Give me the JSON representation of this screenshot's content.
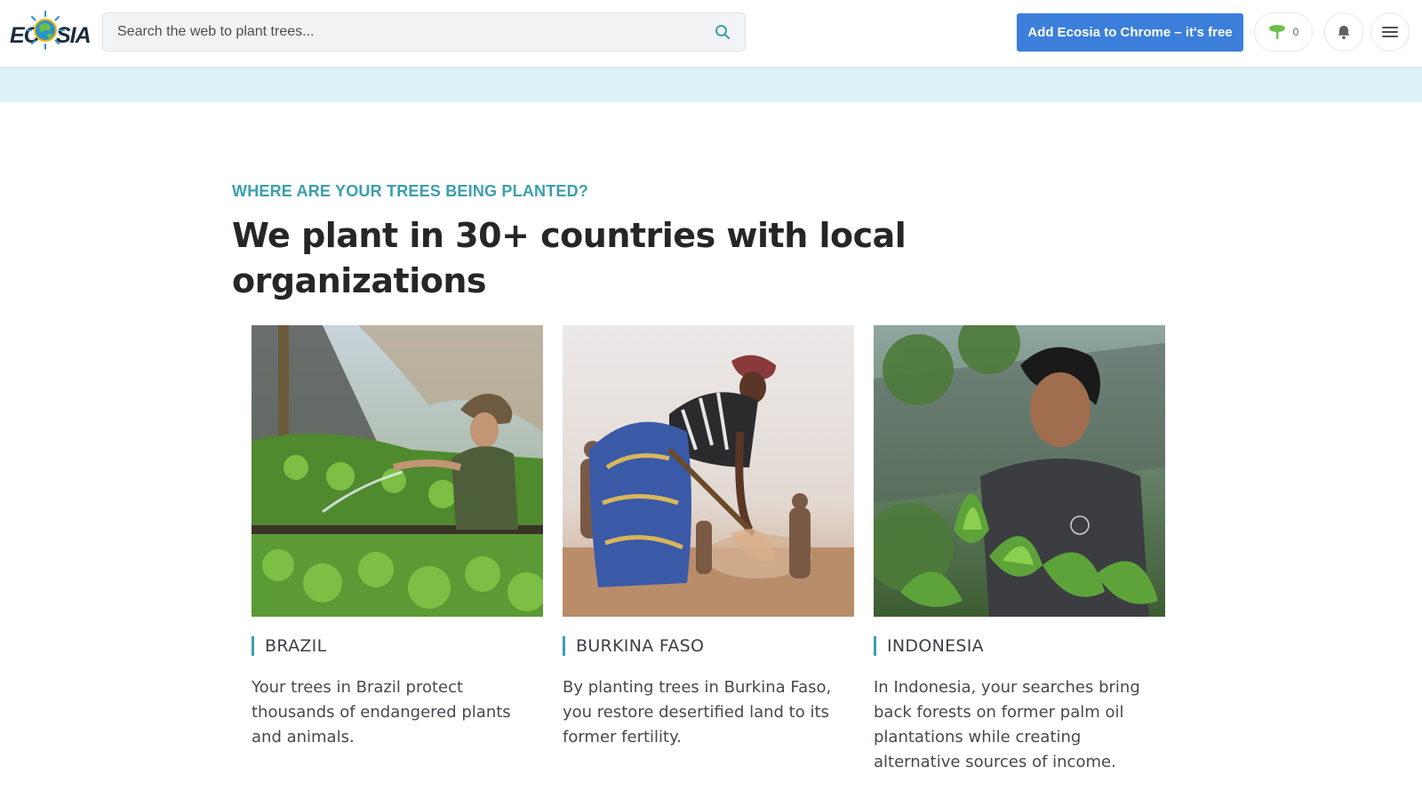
{
  "header": {
    "logo_left": "EC",
    "logo_right": "SIA",
    "search": {
      "placeholder": "Search the web to plant trees...",
      "value": ""
    },
    "chrome_button_label": "Add Ecosia to Chrome – it's free",
    "tree_count": "0",
    "icons": {
      "search": "search-icon",
      "tree": "tree-icon",
      "bell": "bell-icon",
      "menu": "hamburger-menu-icon"
    }
  },
  "main": {
    "eyebrow": "WHERE ARE YOUR TREES BEING PLANTED?",
    "headline": "We plant in 30+ countries with local organizations",
    "cards": [
      {
        "country": "BRAZIL",
        "description": "Your trees in Brazil protect thousands of endangered plants and animals."
      },
      {
        "country": "BURKINA FASO",
        "description": "By planting trees in Burkina Faso, you restore desertified land to its former fertility."
      },
      {
        "country": "INDONESIA",
        "description": "In Indonesia, your searches bring back forests on former palm oil plantations while creating alternative sources of income."
      }
    ]
  },
  "colors": {
    "accent_teal": "#3a9fad",
    "button_blue": "#3b7fdb",
    "banner_bg": "#dcf2f7",
    "heading_text": "#242628"
  }
}
